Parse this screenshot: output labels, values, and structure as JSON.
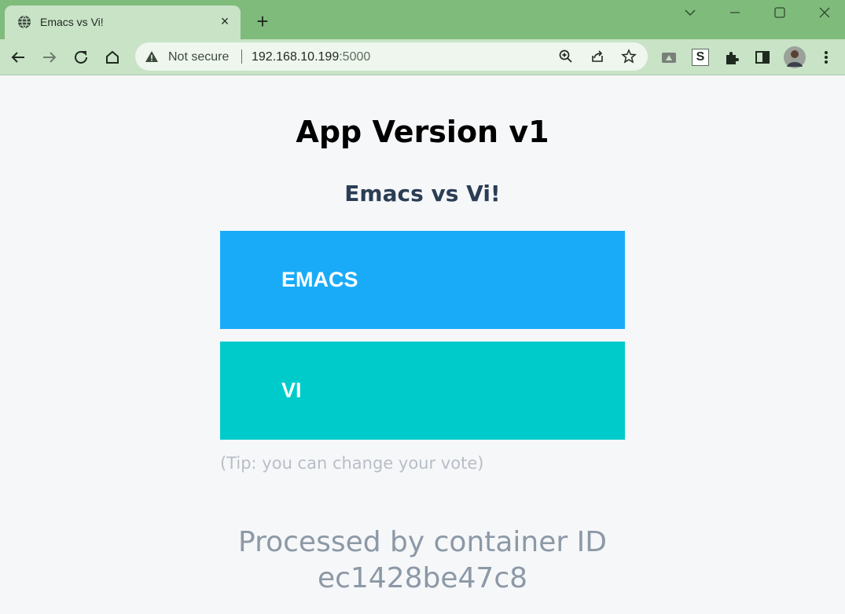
{
  "tab": {
    "title": "Emacs vs Vi!",
    "close_label": "×"
  },
  "new_tab_label": "+",
  "omnibox": {
    "security_label": "Not secure",
    "url_host": "192.168.10.199",
    "url_port": ":5000"
  },
  "extensions": {
    "s_label": "S"
  },
  "page": {
    "title": "App Version v1",
    "subtitle": "Emacs vs Vi!",
    "option_a": "EMACS",
    "option_b": "VI",
    "tip": "(Tip: you can change your vote)",
    "processed_label": "Processed by container ID",
    "container_id": "ec1428be47c8"
  },
  "colors": {
    "tab_strip": "#7fbb7b",
    "toolbar": "#c8e3c6",
    "option_a_bg": "#1aabf8",
    "option_b_bg": "#00cbcb"
  }
}
